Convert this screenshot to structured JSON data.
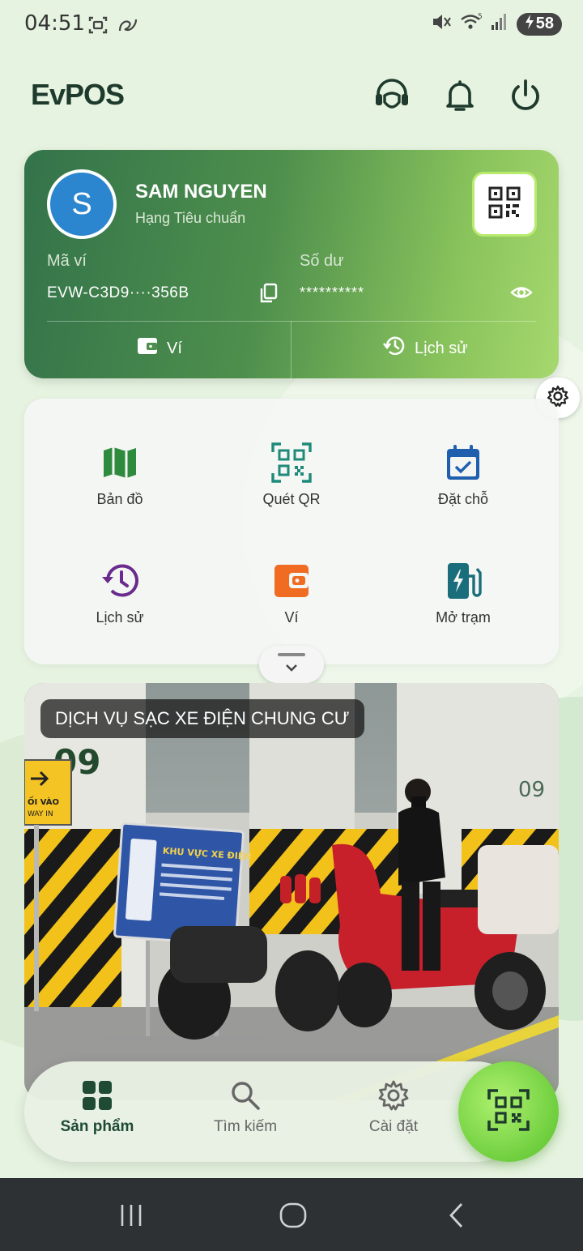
{
  "status_bar": {
    "time": "04:51",
    "battery": "58",
    "icons": [
      "screenshot-icon",
      "link-icon",
      "mute-icon",
      "wifi-icon",
      "signal-icon",
      "battery-charging-icon"
    ]
  },
  "header": {
    "logo": "EvPOS",
    "icons": [
      "support-agent-icon",
      "bell-icon",
      "power-icon"
    ]
  },
  "wallet_card": {
    "avatar_letter": "S",
    "user_name": "SAM NGUYEN",
    "tier": "Hạng Tiêu chuẩn",
    "wallet_label": "Mã ví",
    "wallet_id": "EVW-C3D9····356B",
    "balance_label": "Số dư",
    "balance_masked": "**********",
    "actions": [
      {
        "label": "Ví",
        "icon": "wallet-icon"
      },
      {
        "label": "Lịch sử",
        "icon": "history-icon"
      }
    ]
  },
  "quick_menu": {
    "items": [
      {
        "label": "Bản đồ",
        "icon": "map-icon",
        "color": "#2e8a3c"
      },
      {
        "label": "Quét QR",
        "icon": "qr-scan-icon",
        "color": "#1e8a7a"
      },
      {
        "label": "Đặt chỗ",
        "icon": "calendar-check-icon",
        "color": "#1f5fae"
      },
      {
        "label": "Lịch sử",
        "icon": "history-icon",
        "color": "#6a2a8e"
      },
      {
        "label": "Ví",
        "icon": "wallet-icon",
        "color": "#ef6c22"
      },
      {
        "label": "Mở trạm",
        "icon": "ev-station-icon",
        "color": "#1a6d7a"
      }
    ]
  },
  "banner": {
    "title": "DỊCH VỤ SẠC XE ĐIỆN CHUNG CƯ",
    "sign_text": "KHU VỰC XE ĐIỆN",
    "arrow_sign_text": "ỐI VÀO",
    "arrow_sign_subtext": "WAY IN",
    "pillar_label": "09",
    "pillar_label_right": "09"
  },
  "bottom_nav": {
    "items": [
      {
        "label": "Sản phẩm",
        "icon": "grid-icon",
        "active": true
      },
      {
        "label": "Tìm kiếm",
        "icon": "search-icon",
        "active": false
      },
      {
        "label": "Cài đặt",
        "icon": "gear-icon",
        "active": false
      }
    ],
    "fab_icon": "qr-scan-icon"
  },
  "colors": {
    "accent": "#7ed348",
    "brand_dark": "#1d3a2c",
    "card_gradient_start": "#33734a",
    "card_gradient_end": "#a6d86e"
  }
}
